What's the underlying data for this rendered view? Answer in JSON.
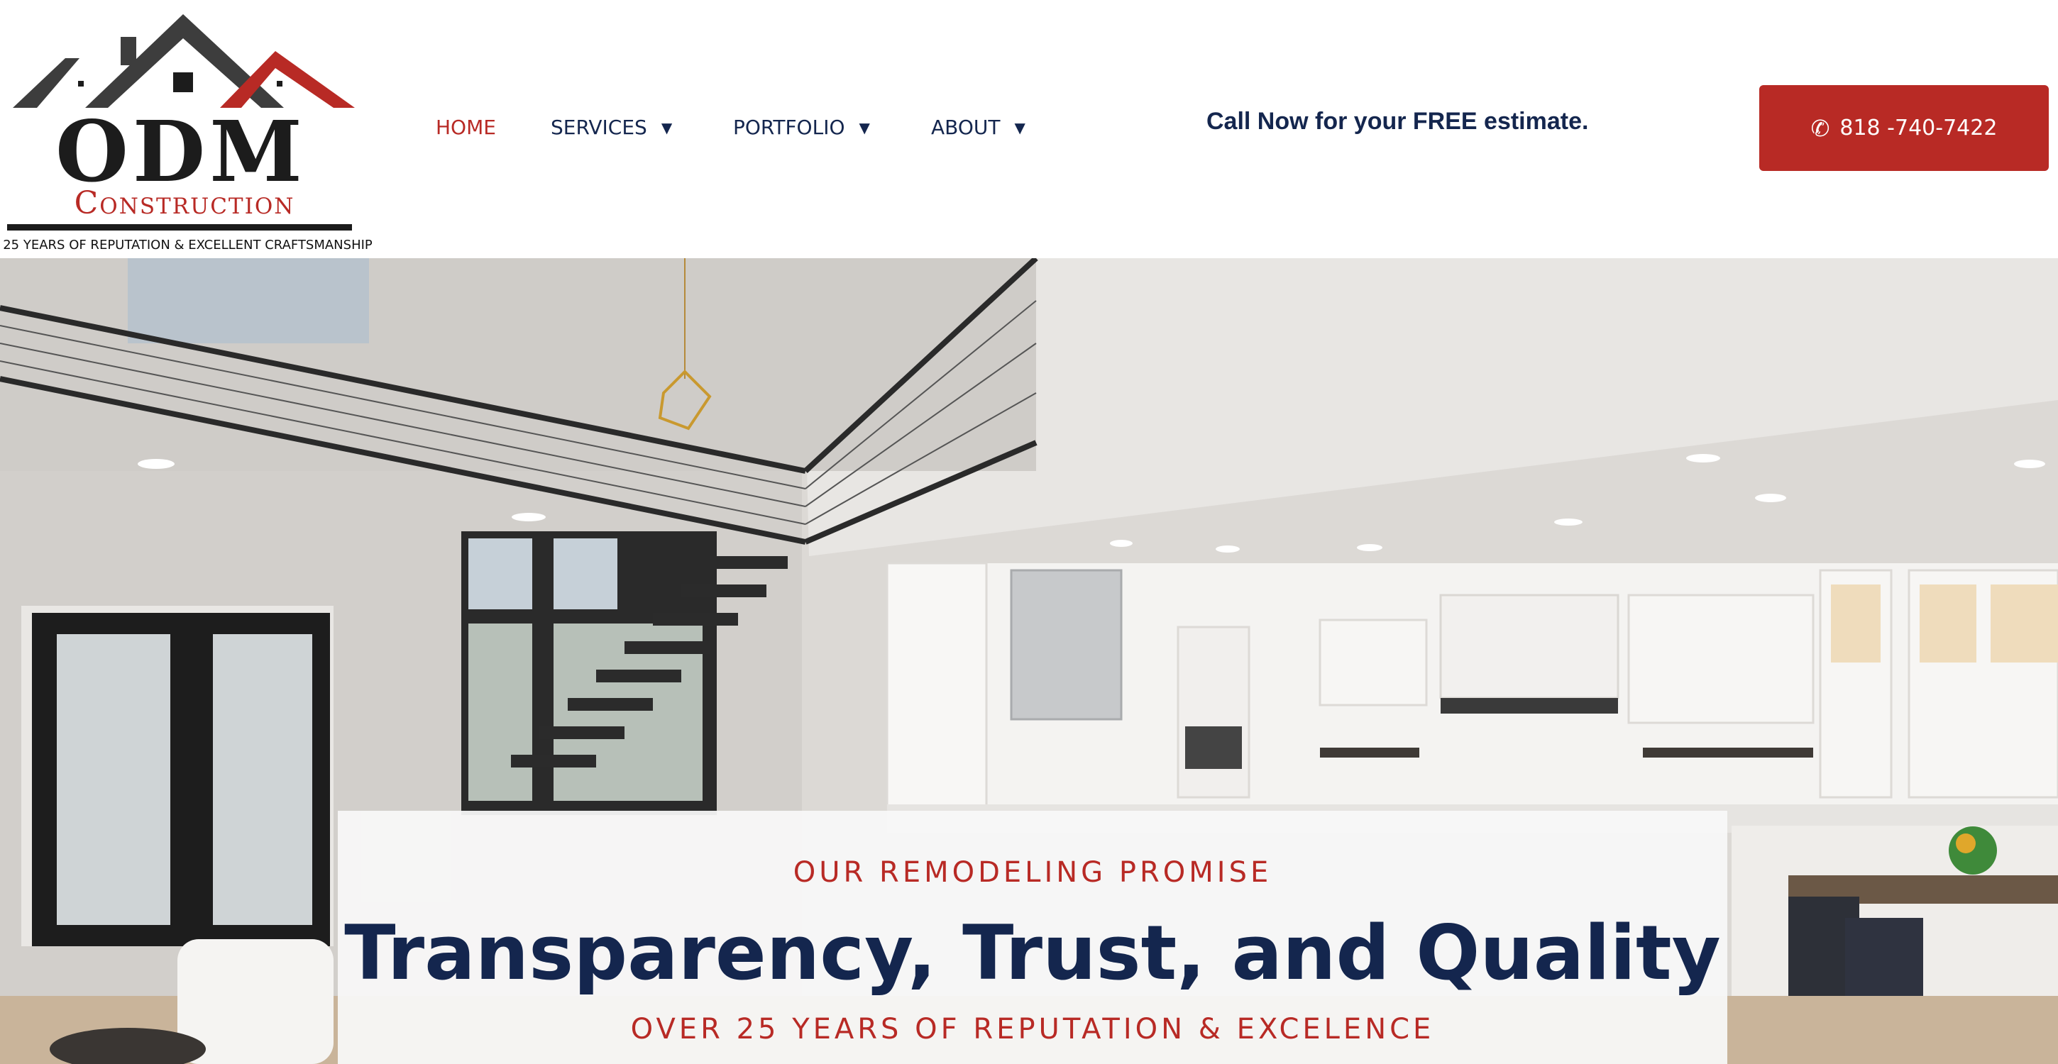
{
  "logo": {
    "wordmark": "ODM",
    "subword": "Construction",
    "tagline": "R 25 YEARS OF REPUTATION & EXCELLENT CRAFTSMANSHIP",
    "colors": {
      "dark": "#1c1c1c",
      "red": "#b82a25",
      "roof_gray": "#3d3d3d"
    }
  },
  "nav": {
    "items": [
      {
        "label": "HOME",
        "active": true,
        "has_dropdown": false
      },
      {
        "label": "SERVICES",
        "active": false,
        "has_dropdown": true
      },
      {
        "label": "PORTFOLIO",
        "active": false,
        "has_dropdown": true
      },
      {
        "label": "ABOUT",
        "active": false,
        "has_dropdown": true
      }
    ],
    "caret_icon": "caret-down-icon"
  },
  "callout": "Call Now for your FREE estimate.",
  "phone_button": {
    "label": "818 -740-7422",
    "icon": "phone-icon"
  },
  "hero": {
    "image": "bright modern kitchen interior with open staircase and loft railing"
  },
  "promise": {
    "kicker": "OUR REMODELING PROMISE",
    "title": "Transparency, Trust, and Quality",
    "subtitle": "OVER 25 YEARS OF REPUTATION & EXCELENCE"
  },
  "colors": {
    "navy": "#14264e",
    "accent_red": "#b82a25",
    "white": "#ffffff"
  }
}
